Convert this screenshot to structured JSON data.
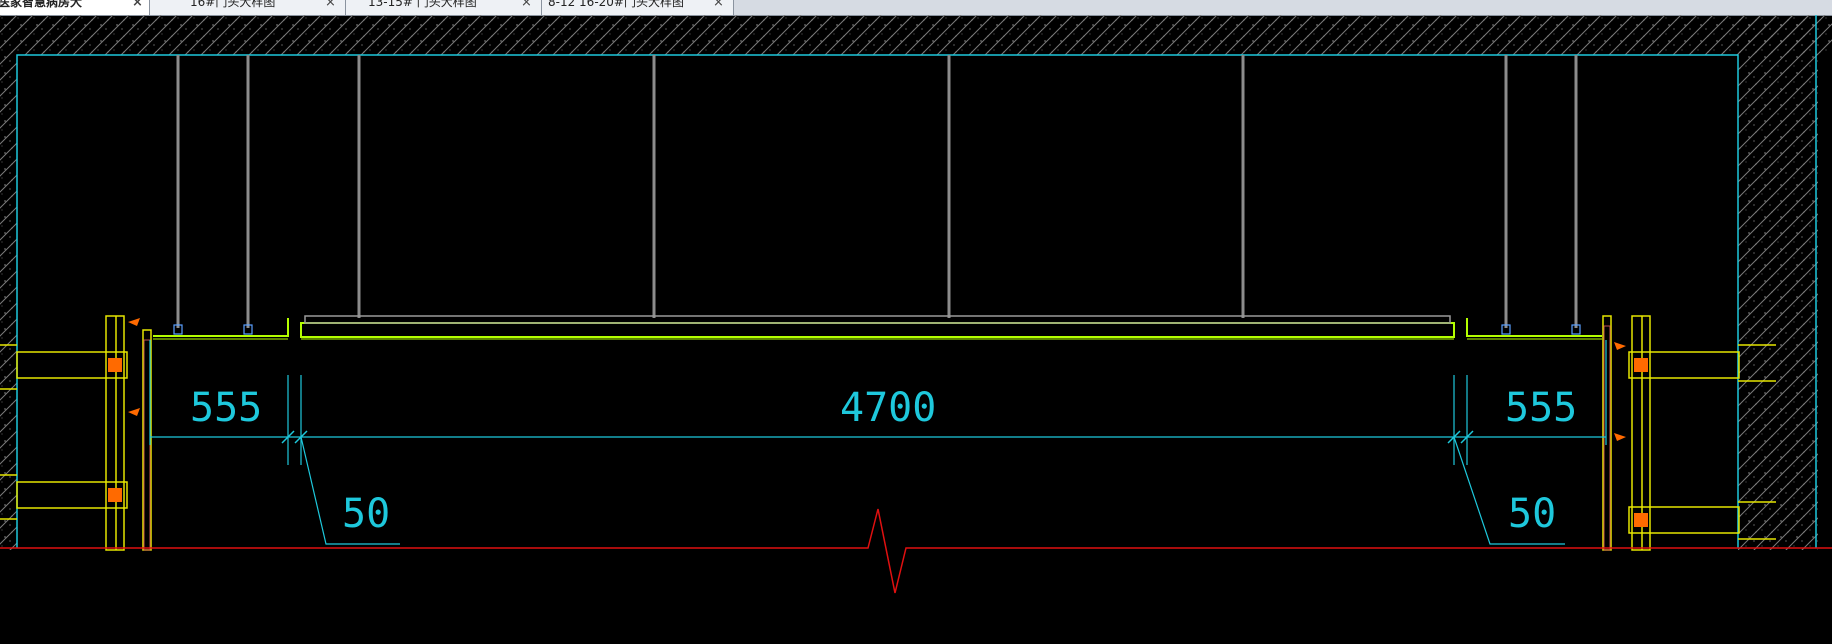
{
  "tabs": [
    {
      "label": "医家智慧病房大",
      "close": "×",
      "active": true
    },
    {
      "label": "16#门头大样图",
      "close": "×",
      "active": false
    },
    {
      "label": "13-15# 门头大样图",
      "close": "×",
      "active": false
    },
    {
      "label": "8-12 16-20#门头大样图",
      "close": "×",
      "active": false
    }
  ],
  "drawing": {
    "dimensions": {
      "left_span": "555",
      "center_span": "4700",
      "right_span": "555",
      "left_gap": "50",
      "right_gap": "50"
    },
    "colors": {
      "background": "#000000",
      "dimension": "#1ec8dc",
      "ceiling_profile": "#b4ff00",
      "hanger_rod": "#8c8c8c",
      "wall_frame": "#e6e600",
      "break_line": "#e01010",
      "hatch": "#7a7a7a",
      "anchor": "#ff6a00"
    }
  }
}
